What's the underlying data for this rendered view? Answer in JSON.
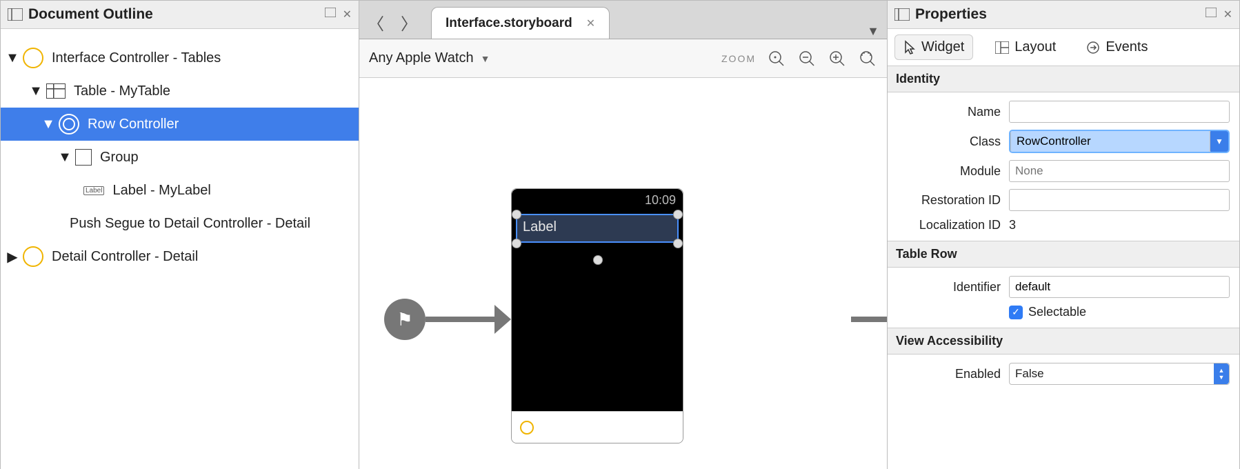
{
  "outline": {
    "title": "Document Outline",
    "items": {
      "interfaceController": "Interface Controller - Tables",
      "table": "Table - MyTable",
      "rowController": "Row Controller",
      "group": "Group",
      "labelItem": "Label - MyLabel",
      "labelBadge": "Label",
      "segue": "Push Segue to Detail Controller - Detail",
      "detailController": "Detail Controller - Detail"
    }
  },
  "editor": {
    "tabTitle": "Interface.storyboard",
    "device": "Any Apple Watch",
    "zoomLabel": "ZOOM",
    "watchTime": "10:09",
    "rowLabel": "Label"
  },
  "properties": {
    "title": "Properties",
    "tabs": {
      "widget": "Widget",
      "layout": "Layout",
      "events": "Events"
    },
    "sections": {
      "identity": "Identity",
      "tableRow": "Table Row",
      "viewAccessibility": "View Accessibility"
    },
    "identity": {
      "nameLabel": "Name",
      "nameValue": "",
      "classLabel": "Class",
      "classValue": "RowController",
      "moduleLabel": "Module",
      "modulePlaceholder": "None",
      "restorationIdLabel": "Restoration ID",
      "restorationIdValue": "",
      "localizationIdLabel": "Localization ID",
      "localizationIdValue": "3"
    },
    "tableRow": {
      "identifierLabel": "Identifier",
      "identifierValue": "default",
      "selectableLabel": "Selectable",
      "selectableChecked": true
    },
    "accessibility": {
      "enabledLabel": "Enabled",
      "enabledValue": "False"
    }
  }
}
